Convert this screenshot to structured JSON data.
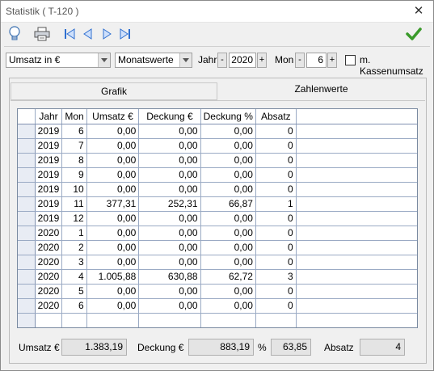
{
  "window": {
    "title": "Statistik ( T-120 )"
  },
  "toolbar": {
    "buttons": [
      {
        "icon": "lightbulb-icon"
      },
      {
        "icon": "printer-icon"
      },
      {
        "icon": "first-record-icon"
      },
      {
        "icon": "previous-record-icon"
      },
      {
        "icon": "next-record-icon"
      },
      {
        "icon": "last-record-icon"
      },
      {
        "icon": "checkmark-icon"
      }
    ]
  },
  "filters": {
    "value_type": "Umsatz in €",
    "period_type": "Monatswerte",
    "year_label": "Jahr",
    "year_value": "2020",
    "month_label": "Mon",
    "month_value": "6",
    "spin_minus": "-",
    "spin_plus": "+",
    "kassenumsatz_label": "m. Kassenumsatz",
    "kassenumsatz_checked": false
  },
  "tabs": {
    "grafik": "Grafik",
    "zahlenwerte": "Zahlenwerte",
    "active": "zahlenwerte"
  },
  "table": {
    "headers": [
      "Jahr",
      "Mon",
      "Umsatz €",
      "Deckung €",
      "Deckung %",
      "Absatz"
    ],
    "rows": [
      [
        "2019",
        "6",
        "0,00",
        "0,00",
        "0,00",
        "0"
      ],
      [
        "2019",
        "7",
        "0,00",
        "0,00",
        "0,00",
        "0"
      ],
      [
        "2019",
        "8",
        "0,00",
        "0,00",
        "0,00",
        "0"
      ],
      [
        "2019",
        "9",
        "0,00",
        "0,00",
        "0,00",
        "0"
      ],
      [
        "2019",
        "10",
        "0,00",
        "0,00",
        "0,00",
        "0"
      ],
      [
        "2019",
        "11",
        "377,31",
        "252,31",
        "66,87",
        "1"
      ],
      [
        "2019",
        "12",
        "0,00",
        "0,00",
        "0,00",
        "0"
      ],
      [
        "2020",
        "1",
        "0,00",
        "0,00",
        "0,00",
        "0"
      ],
      [
        "2020",
        "2",
        "0,00",
        "0,00",
        "0,00",
        "0"
      ],
      [
        "2020",
        "3",
        "0,00",
        "0,00",
        "0,00",
        "0"
      ],
      [
        "2020",
        "4",
        "1.005,88",
        "630,88",
        "62,72",
        "3"
      ],
      [
        "2020",
        "5",
        "0,00",
        "0,00",
        "0,00",
        "0"
      ],
      [
        "2020",
        "6",
        "0,00",
        "0,00",
        "0,00",
        "0"
      ]
    ]
  },
  "totals": {
    "umsatz_label": "Umsatz €",
    "umsatz_value": "1.383,19",
    "deckung_label": "Deckung €",
    "deckung_value": "883,19",
    "percent_label": "%",
    "percent_value": "63,85",
    "absatz_label": "Absatz",
    "absatz_value": "4"
  }
}
